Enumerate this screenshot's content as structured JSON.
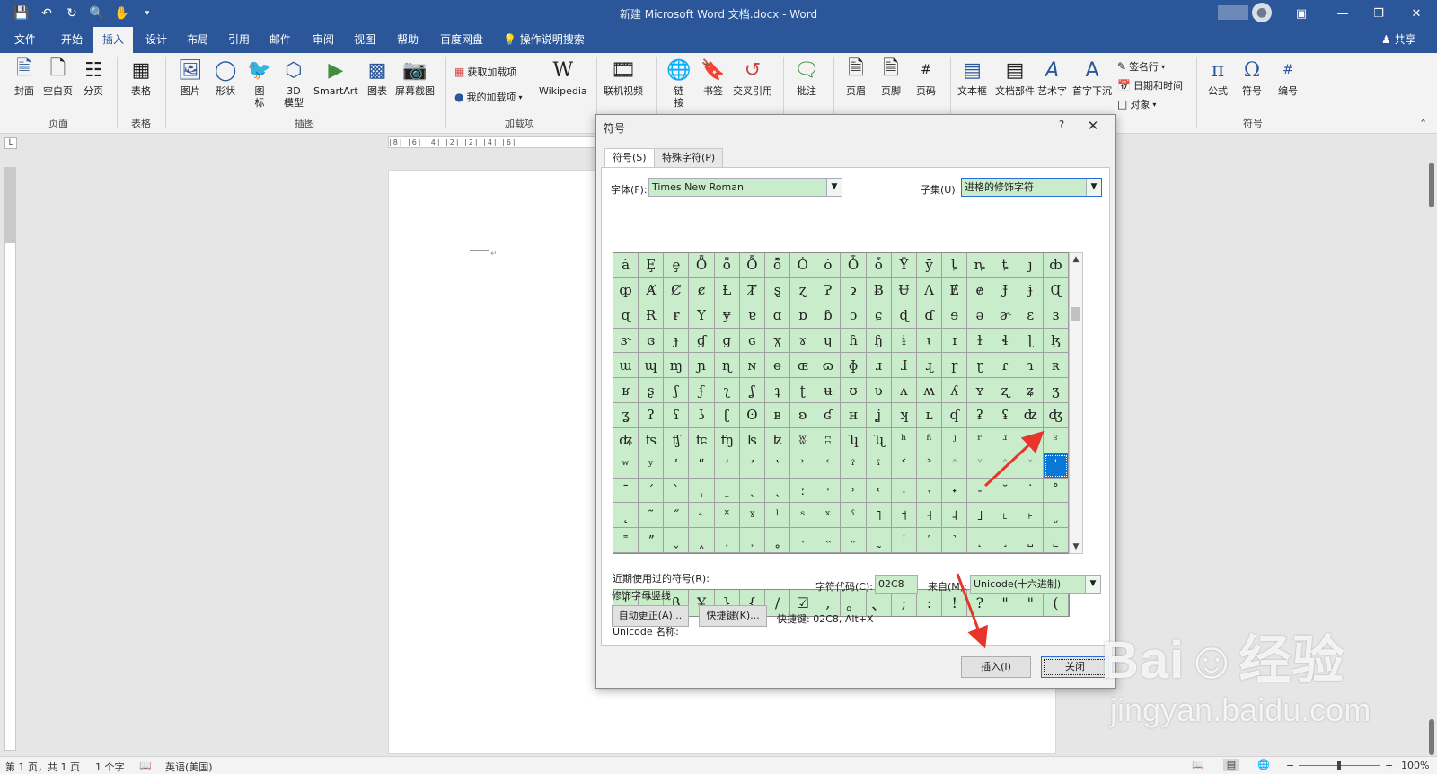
{
  "titlebar": {
    "qat": [
      "save-icon",
      "undo-icon",
      "redo-icon",
      "print-preview-icon",
      "touch-mode-icon",
      "customize-icon"
    ],
    "doc_title": "新建 Microsoft Word 文档.docx  -  Word"
  },
  "tabs": [
    "文件",
    "开始",
    "插入",
    "设计",
    "布局",
    "引用",
    "邮件",
    "审阅",
    "视图",
    "帮助",
    "百度网盘"
  ],
  "active_tab": "插入",
  "tell_me": "操作说明搜索",
  "share": "共享",
  "ribbon": {
    "pages": {
      "cover": "封面",
      "blank": "空白页",
      "break": "分页",
      "group": "页面"
    },
    "tables": {
      "table": "表格",
      "group": "表格"
    },
    "illustrations": {
      "pictures": "图片",
      "shapes": "形状",
      "icons": "图\n标",
      "model3d": "3D\n模型",
      "smartart": "SmartArt",
      "chart": "图表",
      "screenshot": "屏幕截图",
      "group": "插图"
    },
    "addins": {
      "get": "获取加载项",
      "mine": "我的加载项",
      "wikipedia": "Wikipedia",
      "group": "加载项"
    },
    "media": {
      "online_video": "联机视频"
    },
    "links": {
      "link": "链\n接",
      "bookmark": "书签",
      "crossref": "交叉引用"
    },
    "comments": {
      "comment": "批注"
    },
    "header_footer": {
      "header": "页眉",
      "footer": "页脚",
      "page_number": "页码"
    },
    "text": {
      "textbox": "文本框",
      "quickparts": "文档部件",
      "wordart": "艺术字",
      "dropcap": "首字下沉",
      "signature": "签名行",
      "datetime": "日期和时间",
      "object": "对象"
    },
    "symbols": {
      "equation": "公式",
      "symbol": "符号",
      "number": "编号",
      "group": "符号"
    }
  },
  "ruler_text": "|8| |6| |4| |2|    |2| |4| |6|",
  "status": {
    "page": "第 1 页，共 1 页",
    "words": "1 个字",
    "language": "英语(美国)",
    "zoom": "100%"
  },
  "dialog": {
    "title": "符号",
    "help": "?",
    "close": "✕",
    "tab_symbols": "符号(S)",
    "tab_special": "特殊字符(P)",
    "font_label": "字体(F):",
    "font_value": "Times New Roman",
    "subset_label": "子集(U):",
    "subset_value": "进格的修饰字符",
    "grid": [
      "ȧ",
      "Ȩ",
      "ȩ",
      "Ȫ",
      "ȫ",
      "Ȭ",
      "ȭ",
      "Ȯ",
      "ȯ",
      "Ȱ",
      "ȱ",
      "Ȳ",
      "ȳ",
      "ȴ",
      "ȵ",
      "ȶ",
      "ȷ",
      "ȸ",
      "ȹ",
      "Ⱥ",
      "Ȼ",
      "ȼ",
      "Ƚ",
      "Ⱦ",
      "ȿ",
      "ɀ",
      "Ɂ",
      "ɂ",
      "Ƀ",
      "Ʉ",
      "Ʌ",
      "Ɇ",
      "ɇ",
      "Ɉ",
      "ɉ",
      "Ɋ",
      "ɋ",
      "Ɍ",
      "ɍ",
      "Ɏ",
      "ɏ",
      "ɐ",
      "ɑ",
      "ɒ",
      "ɓ",
      "ɔ",
      "ɕ",
      "ɖ",
      "ɗ",
      "ɘ",
      "ə",
      "ɚ",
      "ɛ",
      "ɜ",
      "ɝ",
      "ɞ",
      "ɟ",
      "ɠ",
      "ɡ",
      "ɢ",
      "ɣ",
      "ɤ",
      "ɥ",
      "ɦ",
      "ɧ",
      "ɨ",
      "ɩ",
      "ɪ",
      "ɫ",
      "ɬ",
      "ɭ",
      "ɮ",
      "ɯ",
      "ɰ",
      "ɱ",
      "ɲ",
      "ɳ",
      "ɴ",
      "ɵ",
      "ɶ",
      "ɷ",
      "ɸ",
      "ɹ",
      "ɺ",
      "ɻ",
      "ɼ",
      "ɽ",
      "ɾ",
      "ɿ",
      "ʀ",
      "ʁ",
      "ʂ",
      "ʃ",
      "ʄ",
      "ʅ",
      "ʆ",
      "ʇ",
      "ʈ",
      "ʉ",
      "ʊ",
      "ʋ",
      "ʌ",
      "ʍ",
      "ʎ",
      "ʏ",
      "ʐ",
      "ʑ",
      "ʒ",
      "ʓ",
      "ʔ",
      "ʕ",
      "ʖ",
      "ʗ",
      "ʘ",
      "ʙ",
      "ʚ",
      "ʛ",
      "ʜ",
      "ʝ",
      "ʞ",
      "ʟ",
      "ʠ",
      "ʡ",
      "ʢ",
      "ʣ",
      "ʤ",
      "ʥ",
      "ʦ",
      "ʧ",
      "ʨ",
      "ʩ",
      "ʪ",
      "ʫ",
      "ʬ",
      "ʭ",
      "ʮ",
      "ʯ",
      "ʰ",
      "ʱ",
      "ʲ",
      "ʳ",
      "ʴ",
      "ʵ",
      "ʶ",
      "ʷ",
      "ʸ",
      "ʹ",
      "ʺ",
      "ʻ",
      "ʼ",
      "ʽ",
      "ʾ",
      "ʿ",
      "ˀ",
      "ˁ",
      "˂",
      "˃",
      "˄",
      "˅",
      "ˆ",
      "ˇ",
      "ˈ",
      "ˉ",
      "ˊ",
      "ˋ",
      "ˌ",
      "ˍ",
      "ˎ",
      "ˏ",
      "ː",
      "ˑ",
      "˒",
      "˓",
      "˔",
      "˕",
      "˖",
      "˗",
      "˘",
      "˙",
      "˚",
      "˛",
      "˜",
      "˝",
      "˞",
      "˟",
      "ˠ",
      "ˡ",
      "ˢ",
      "ˣ",
      "ˤ",
      "˥",
      "˦",
      "˧",
      "˨",
      "˩",
      "˪",
      "˫",
      "ˬ",
      "˭",
      "ˮ",
      "˯",
      "˰",
      "˱",
      "˲",
      "˳",
      "˴",
      "˵",
      "˶",
      "˷",
      "˸",
      "˹",
      "˺",
      "˻",
      "˼",
      "˽",
      "˾"
    ],
    "selected_index": 161,
    "dim_indices": [
      157,
      158,
      159,
      160
    ],
    "recent_label": "近期使用过的符号(R):",
    "recent": [
      "'",
      "`",
      "β",
      "¥",
      "}",
      "{",
      "/",
      "☑",
      ",",
      "。",
      "、",
      ";",
      ":",
      "!",
      "?",
      "\"",
      "\"",
      "("
    ],
    "unicode_name_label": "Unicode 名称:",
    "unicode_name": "修饰字母竖线",
    "char_code_label": "字符代码(C):",
    "char_code": "02C8",
    "from_label": "来自(M):",
    "from_value": "Unicode(十六进制)",
    "autocorrect": "自动更正(A)...",
    "shortcut_key": "快捷键(K)...",
    "shortcut_text": "快捷键: 02C8, Alt+X",
    "insert": "插入(I)",
    "close_btn": "关闭"
  },
  "annotation_color": "#e8342a",
  "watermark": {
    "logo": "Bai☺经验",
    "url": "jingyan.baidu.com"
  }
}
